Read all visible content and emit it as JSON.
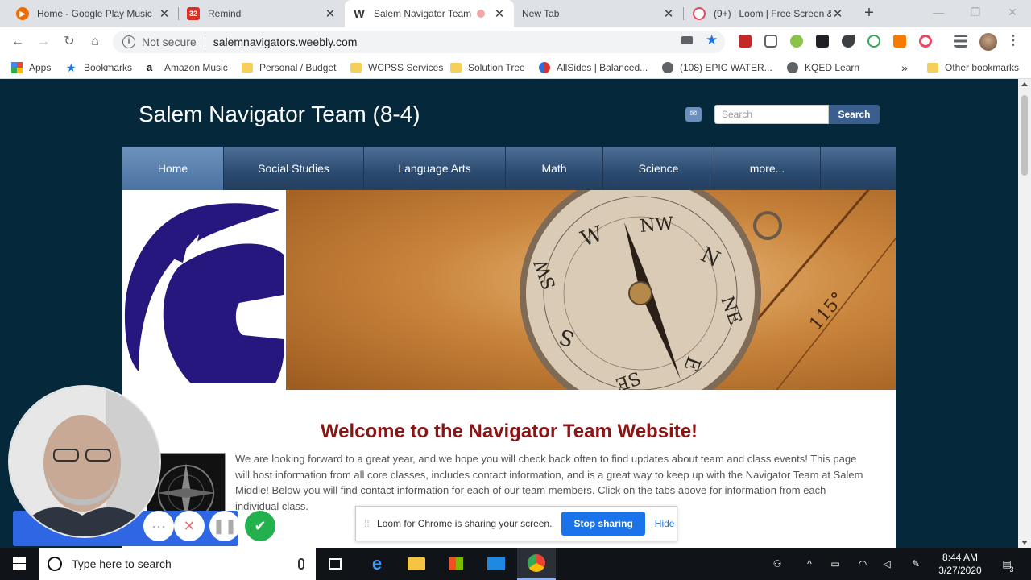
{
  "browser": {
    "tabs": [
      {
        "title": "Home - Google Play Music",
        "icon": "play-music-icon",
        "color": "#ef6c00"
      },
      {
        "title": "Remind",
        "icon": "remind-icon",
        "color": "#d93025",
        "badge": "32"
      },
      {
        "title": "Salem Navigator Team",
        "icon": "weebly-icon",
        "color": "#333333"
      },
      {
        "title": "New Tab",
        "icon": "",
        "color": ""
      },
      {
        "title": "(9+) | Loom | Free Screen &",
        "icon": "loom-icon",
        "color": "#e8475f"
      }
    ],
    "security_label": "Not secure",
    "url": "salemnavigators.weebly.com",
    "bookmarks": [
      {
        "label": "Apps",
        "icon": "apps-grid-icon"
      },
      {
        "label": "Bookmarks",
        "icon": "star-icon"
      },
      {
        "label": "Amazon Music",
        "icon": "amazon-icon"
      },
      {
        "label": "Personal / Budget",
        "icon": "folder-icon"
      },
      {
        "label": "WCPSS Services",
        "icon": "folder-icon"
      },
      {
        "label": "Solution Tree",
        "icon": "folder-icon"
      },
      {
        "label": "AllSides | Balanced...",
        "icon": "allsides-icon"
      },
      {
        "label": "(108) EPIC WATER...",
        "icon": "globe-icon"
      },
      {
        "label": "KQED Learn",
        "icon": "globe-icon"
      }
    ],
    "other_bookmarks": "Other bookmarks",
    "more_bookmarks": "»"
  },
  "site": {
    "title": "Salem Navigator Team (8-4)",
    "search_placeholder": "Search",
    "search_button": "Search",
    "nav": [
      "Home",
      "Social Studies",
      "Language Arts",
      "Math",
      "Science",
      "more..."
    ],
    "welcome": "Welcome to the Navigator Team Website!",
    "intro": "We are looking forward to a great year, and we hope you will check back often to find updates about team and class events! This page will host information from all core classes, includes contact information, and is a great way to keep up with the Navigator Team at Salem Middle! Below you will find contact information for each of our team members. Click on the tabs above for information from each individual class.",
    "compass_letters": [
      "W",
      "NW",
      "N",
      "NE",
      "E",
      "SE",
      "S",
      "SW"
    ],
    "map_mark": "115°"
  },
  "loom": {
    "sharing_message": "Loom for Chrome is sharing your screen.",
    "stop_button": "Stop sharing",
    "hide_button": "Hide"
  },
  "taskbar": {
    "search_placeholder": "Type here to search",
    "time": "8:44 AM",
    "date": "3/27/2020",
    "notification_count": "3"
  },
  "colors": {
    "page_background": "#05283a",
    "nav_blue": "#2b4a70",
    "welcome_red": "#8b1515",
    "loom_blue": "#2e66e4"
  }
}
